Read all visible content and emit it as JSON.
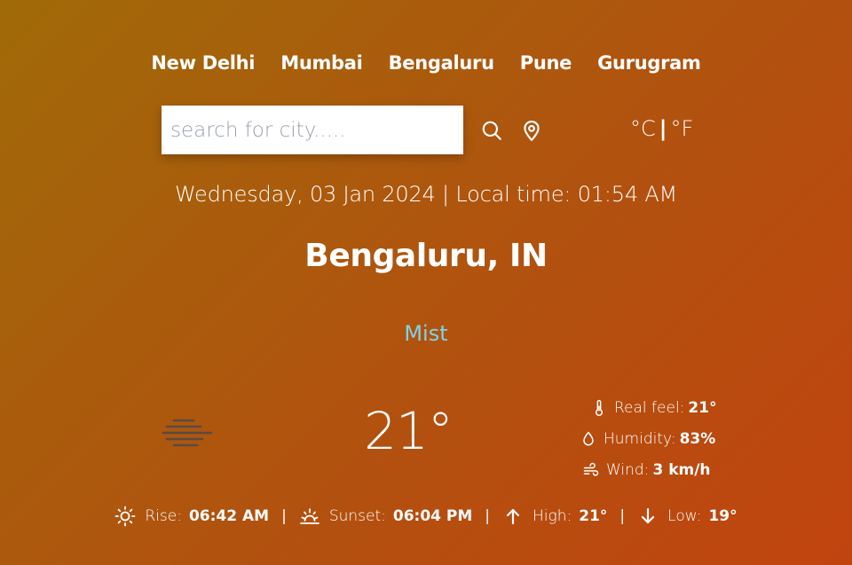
{
  "nav": {
    "cities": [
      "New Delhi",
      "Mumbai",
      "Bengaluru",
      "Pune",
      "Gurugram"
    ]
  },
  "search": {
    "placeholder": "search for city.....",
    "value": "",
    "search_icon": "search-icon",
    "location_icon": "location-pin-icon"
  },
  "units": {
    "celsius": "°C",
    "separator": "|",
    "fahrenheit": "°F"
  },
  "header": {
    "datetime": "Wednesday, 03 Jan 2024 | Local time: 01:54 AM",
    "location": "Bengaluru, IN",
    "condition": "Mist"
  },
  "current": {
    "icon": "mist-icon",
    "temperature": "21°"
  },
  "details": {
    "real_feel_label": "Real feel:",
    "real_feel_value": "21°",
    "humidity_label": "Humidity:",
    "humidity_value": "83%",
    "wind_label": "Wind:",
    "wind_value": "3 km/h"
  },
  "footer": {
    "rise_label": "Rise:",
    "rise_value": "06:42 AM",
    "sunset_label": "Sunset:",
    "sunset_value": "06:04 PM",
    "high_label": "High:",
    "high_value": "21°",
    "low_label": "Low:",
    "low_value": "19°",
    "separator": "|"
  },
  "colors": {
    "background_start": "#a06a08",
    "background_end": "#c1440f",
    "condition_text": "#7fd3e6",
    "text": "#ffffff"
  }
}
